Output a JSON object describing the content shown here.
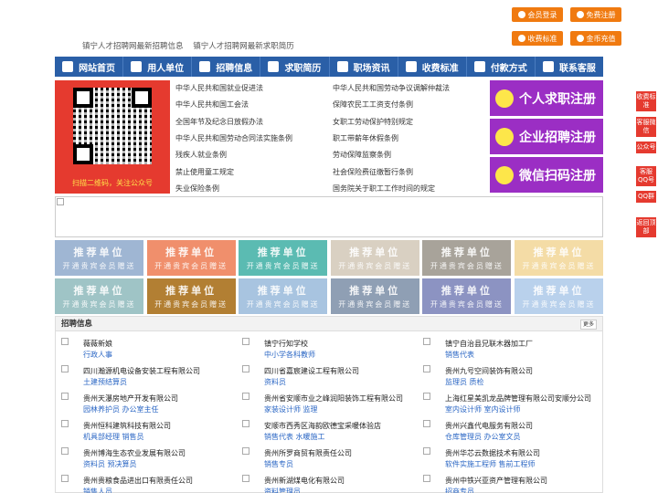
{
  "top_buttons": {
    "member_login": "会员登录",
    "free_register": "免费注册",
    "fee_standard": "收费标准",
    "gold_recharge": "金币充值"
  },
  "top_links": [
    "镇宁人才招聘网最新招聘信息",
    "镇宁人才招聘网最新求职简历"
  ],
  "nav": [
    "网站首页",
    "用人单位",
    "招聘信息",
    "求职简历",
    "职场资讯",
    "收费标准",
    "付款方式",
    "联系客服"
  ],
  "qr_caption": "扫描二维码，关注公众号",
  "links_left": [
    "中华人民共和国就业促进法",
    "中华人民共和国工会法",
    "全国年节及纪念日放假办法",
    "中华人民共和国劳动合同法实施条例",
    "残疾人就业条例",
    "禁止使用童工规定",
    "失业保险条例"
  ],
  "links_right": [
    "中华人民共和国劳动争议调解仲裁法",
    "保障农民工工资支付条例",
    "女职工劳动保护特别规定",
    "职工带薪年休假条例",
    "劳动保障监察条例",
    "社会保险费征缴暂行条例",
    "国务院关于职工工作时间的规定"
  ],
  "registers": [
    "个人求职注册",
    "企业招聘注册",
    "微信扫码注册"
  ],
  "tiles": {
    "title": "推荐单位",
    "sub": "开通贵宾会员赠送",
    "colors": [
      "#9fb6d3",
      "#f08f6c",
      "#5bbbb2",
      "#d9d0c2",
      "#a8a39a",
      "#f4dca6",
      "#9fc4c6",
      "#b27f33",
      "#a8c4e0",
      "#8f9fb4",
      "#8c93c2",
      "#b9d1ec"
    ]
  },
  "jobs_section": {
    "title": "招聘信息",
    "more": "更多"
  },
  "jobs": [
    {
      "company": "薇薇新娘",
      "position": "行政人事"
    },
    {
      "company": "镇宁行知学校",
      "position": "中小学各科教师"
    },
    {
      "company": "镇宁自治县兄联木器加工厂",
      "position": "销售代表"
    },
    {
      "company": "四川瀚源机电设备安装工程有限公司",
      "position": "土建预结算员"
    },
    {
      "company": "四川省嘉宸建设工程有限公司",
      "position": "资料员"
    },
    {
      "company": "贵州九号空间装饰有限公司",
      "position": "监理员 质检"
    },
    {
      "company": "贵州天瀑房地产开发有限公司",
      "position": "园林养护员 办公室主任"
    },
    {
      "company": "贵州省安顺市业之峰润阳装饰工程有限公司",
      "position": "家装设计师 监理"
    },
    {
      "company": "上海红星美凯龙品牌管理有限公司安顺分公司",
      "position": "室内设计师 室内设计师"
    },
    {
      "company": "贵州恒科建筑科技有限公司",
      "position": "机具部经理 销售员"
    },
    {
      "company": "安顺市西秀区海韵欧德宝采暖体验店",
      "position": "销售代表 水暖施工"
    },
    {
      "company": "贵州兴鑫代电服务有限公司",
      "position": "仓库管理员 办公室文员"
    },
    {
      "company": "贵州博海生态农业发展有限公司",
      "position": "资料员 预决算员"
    },
    {
      "company": "贵州所罗商贸有限责任公司",
      "position": "销售专员"
    },
    {
      "company": "贵州华芯云数据技术有限公司",
      "position": "软件实施工程师 售前工程师"
    },
    {
      "company": "贵州贵粮食品进出口有限责任公司",
      "position": "销售人员"
    },
    {
      "company": "贵州新湖煤电化有限公司",
      "position": "资料管理员"
    },
    {
      "company": "贵州中铁兴亚资产管理有限公司",
      "position": "招商专员"
    }
  ],
  "side_tabs": [
    "收费标准",
    "客服微信",
    "公众号",
    "客服QQ号",
    "QQ群",
    "返回顶部"
  ]
}
